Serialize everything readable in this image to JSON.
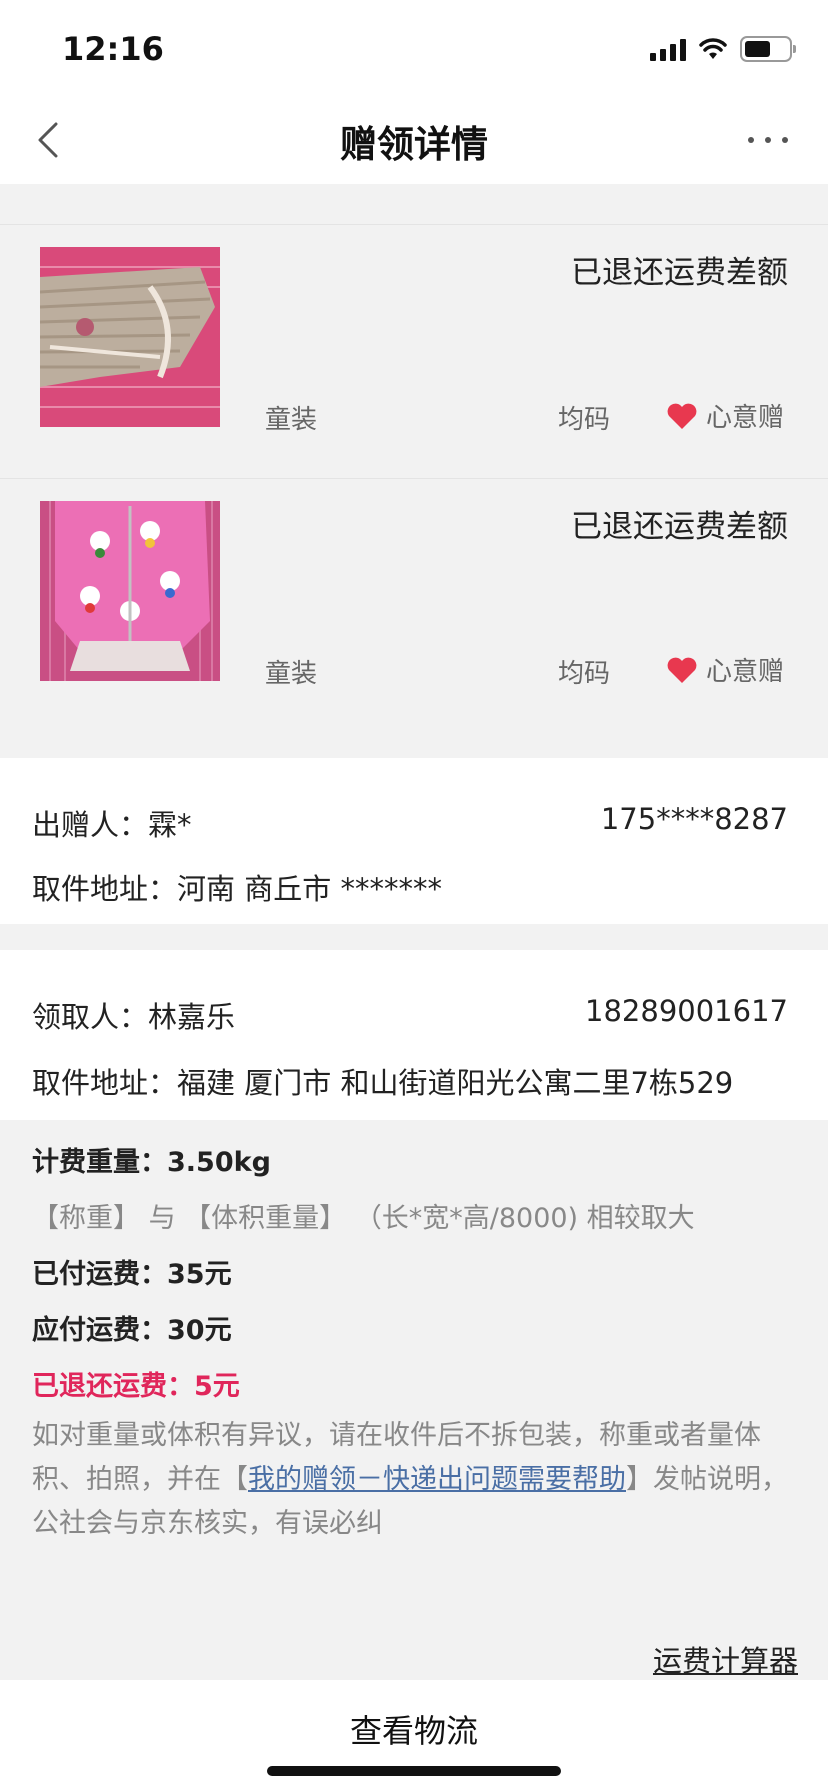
{
  "status_bar": {
    "time": "12:16",
    "battery_level": 0.6
  },
  "nav": {
    "title": "赠领详情",
    "back_icon": "chevron-left-icon",
    "more_icon": "more-dots-icon"
  },
  "items": [
    {
      "status": "已退还运费差额",
      "category": "童装",
      "size": "均码",
      "tag": "心意赠",
      "tag_icon": "heart-icon"
    },
    {
      "status": "已退还运费差额",
      "category": "童装",
      "size": "均码",
      "tag": "心意赠",
      "tag_icon": "heart-icon"
    }
  ],
  "giver": {
    "name_label": "出赠人：",
    "name": "霖*",
    "phone": "175****8287",
    "address_label": "取件地址：",
    "address": "河南 商丘市 *******"
  },
  "receiver": {
    "name_label": "领取人：",
    "name": "林嘉乐",
    "phone": "18289001617",
    "address_label": "取件地址：",
    "address": "福建 厦门市 和山街道阳光公寓二里7栋529"
  },
  "fee": {
    "charged_weight": "计费重量：3.50kg",
    "weight_note": "【称重】 与 【体积重量】 （长*宽*高/8000) 相较取大",
    "paid": "已付运费：35元",
    "payable": "应付运费：30元",
    "refunded": "已退还运费：5元",
    "help_before": "如对重量或体积有异议，请在收件后不拆包装，称重或者量体积、拍照，并在【",
    "help_link": "我的赠领－快递出问题需要帮助",
    "help_after": "】发帖说明，公社会与京东核实，有误必纠"
  },
  "calculator_link": "运费计算器",
  "bottom_button": "查看物流",
  "colors": {
    "accent_red": "#e0265b",
    "link_blue": "#4a6fa5",
    "heart": "#e8384f"
  }
}
